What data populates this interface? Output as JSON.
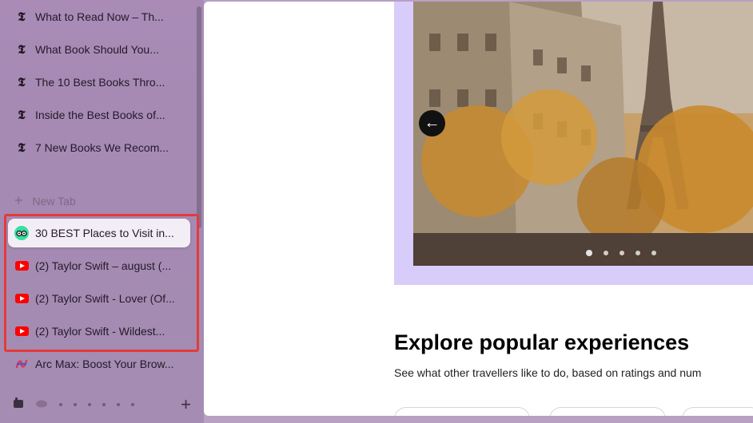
{
  "sidebar": {
    "tabs": [
      {
        "label": "What to Read Now – Th...",
        "icon": "nyt-icon"
      },
      {
        "label": "What Book Should You...",
        "icon": "nyt-icon"
      },
      {
        "label": "The 10 Best Books Thro...",
        "icon": "nyt-icon"
      },
      {
        "label": "Inside the Best Books of...",
        "icon": "nyt-icon"
      },
      {
        "label": "7 New Books We Recom...",
        "icon": "nyt-icon"
      }
    ],
    "new_tab_label": "New Tab",
    "pinned_tabs": [
      {
        "label": "30 BEST Places to Visit in...",
        "icon": "tripadvisor-icon",
        "active": true
      },
      {
        "label": "(2) Taylor Swift – august (...",
        "icon": "youtube-icon"
      },
      {
        "label": "(2) Taylor Swift - Lover (Of...",
        "icon": "youtube-icon"
      },
      {
        "label": "(2) Taylor Swift - Wildest...",
        "icon": "youtube-icon"
      }
    ],
    "extra_tab": {
      "label": "Arc Max: Boost Your Brow...",
      "icon": "arc-icon"
    },
    "nyt_glyph": "𝕿",
    "plus_glyph": "+",
    "new_tab_plus": "+"
  },
  "main": {
    "carousel": {
      "prev_glyph": "←",
      "dot_count": 5,
      "active_dot": 0
    },
    "section_title": "Explore popular experiences",
    "section_subtitle": "See what other travellers like to do, based on ratings and num"
  },
  "colors": {
    "highlight": "#e53a3a",
    "hero_background": "#d8ccfa",
    "youtube_red": "#ff0000",
    "tripadvisor_green": "#34e0a1"
  }
}
